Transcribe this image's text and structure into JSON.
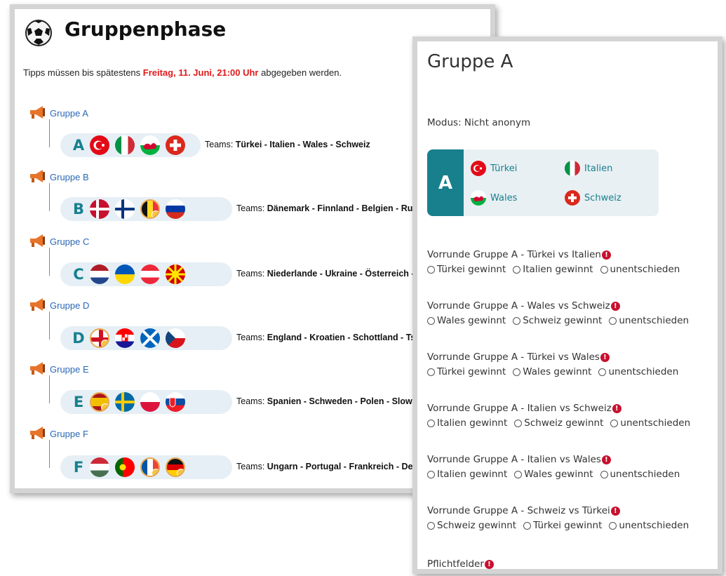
{
  "left": {
    "title": "Gruppenphase",
    "notice_pre": "Tipps müssen bis spätestens ",
    "notice_deadline": "Freitag, 11. Juni, 21:00 Uhr",
    "notice_post": " abgegeben werden.",
    "teams_prefix": "Teams:",
    "groups": [
      {
        "link": "Gruppe A",
        "letter": "A",
        "teams": "Türkei - Italien - Wales - Schweiz",
        "flags": [
          "turkey-flag-icon",
          "italy-flag-icon",
          "wales-flag-icon",
          "switzerland-flag-icon"
        ]
      },
      {
        "link": "Gruppe B",
        "letter": "B",
        "teams": "Dänemark - Finnland - Belgien - Russland",
        "flags": [
          "denmark-flag-icon",
          "finland-flag-icon",
          "belgium-flag-icon",
          "russia-flag-icon"
        ]
      },
      {
        "link": "Gruppe C",
        "letter": "C",
        "teams": "Niederlande - Ukraine - Österreich - Nord",
        "flags": [
          "netherlands-flag-icon",
          "ukraine-flag-icon",
          "austria-flag-icon",
          "north-macedonia-flag-icon"
        ]
      },
      {
        "link": "Gruppe D",
        "letter": "D",
        "teams": "England - Kroatien - Schottland - Tschech",
        "flags": [
          "england-flag-icon",
          "croatia-flag-icon",
          "scotland-flag-icon",
          "czechia-flag-icon"
        ]
      },
      {
        "link": "Gruppe E",
        "letter": "E",
        "teams": "Spanien - Schweden - Polen - Slowakei",
        "flags": [
          "spain-flag-icon",
          "sweden-flag-icon",
          "poland-flag-icon",
          "slovakia-flag-icon"
        ]
      },
      {
        "link": "Gruppe F",
        "letter": "F",
        "teams": "Ungarn - Portugal - Frankreich - Deutschl",
        "flags": [
          "hungary-flag-icon",
          "portugal-flag-icon",
          "france-flag-icon",
          "germany-flag-icon"
        ]
      }
    ]
  },
  "right": {
    "title": "Gruppe A",
    "modus": "Modus: Nicht anonym",
    "box_letter": "A",
    "box_teams": [
      "Türkei",
      "Italien",
      "Wales",
      "Schweiz"
    ],
    "questions": [
      {
        "label": "Vorrunde Gruppe A - Türkei vs Italien",
        "options": [
          "Türkei gewinnt",
          "Italien gewinnt",
          "unentschieden"
        ]
      },
      {
        "label": "Vorrunde Gruppe A - Wales vs Schweiz",
        "options": [
          "Wales gewinnt",
          "Schweiz gewinnt",
          "unentschieden"
        ]
      },
      {
        "label": "Vorrunde Gruppe A - Türkei vs Wales",
        "options": [
          "Türkei gewinnt",
          "Wales gewinnt",
          "unentschieden"
        ]
      },
      {
        "label": "Vorrunde Gruppe A - Italien vs Schweiz",
        "options": [
          "Italien gewinnt",
          "Schweiz gewinnt",
          "unentschieden"
        ]
      },
      {
        "label": "Vorrunde Gruppe A - Italien vs Wales",
        "options": [
          "Italien gewinnt",
          "Wales gewinnt",
          "unentschieden"
        ]
      },
      {
        "label": "Vorrunde Gruppe A - Schweiz vs Türkei",
        "options": [
          "Schweiz gewinnt",
          "Türkei gewinnt",
          "unentschieden"
        ]
      }
    ],
    "required_label": "Pflichtfelder",
    "required_icon_text": "!"
  },
  "colors": {
    "teal": "#187f8d",
    "link": "#2a68b5",
    "deadline": "#e01919",
    "required": "#c8102e"
  }
}
